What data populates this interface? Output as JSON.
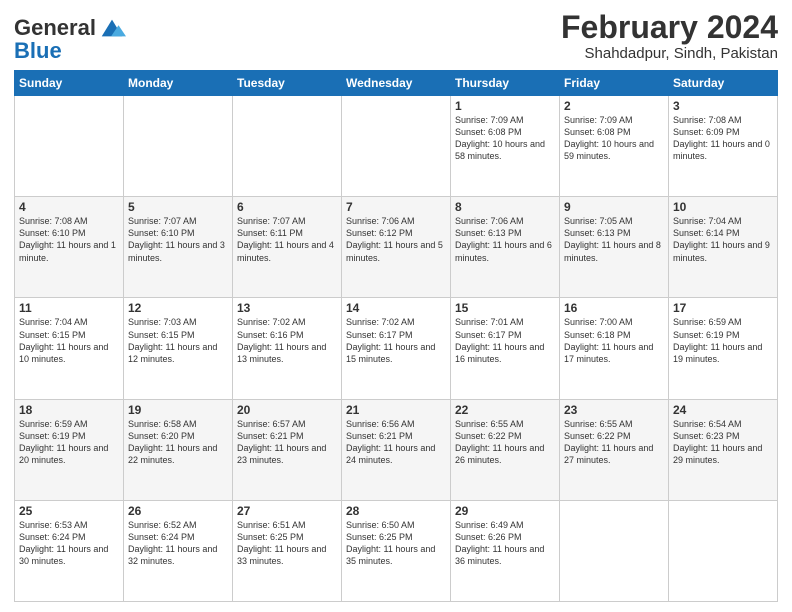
{
  "header": {
    "logo": {
      "text_general": "General",
      "text_blue": "Blue"
    },
    "title": "February 2024",
    "subtitle": "Shahdadpur, Sindh, Pakistan"
  },
  "weekdays": [
    "Sunday",
    "Monday",
    "Tuesday",
    "Wednesday",
    "Thursday",
    "Friday",
    "Saturday"
  ],
  "weeks": [
    [
      {
        "day": "",
        "info": ""
      },
      {
        "day": "",
        "info": ""
      },
      {
        "day": "",
        "info": ""
      },
      {
        "day": "",
        "info": ""
      },
      {
        "day": "1",
        "info": "Sunrise: 7:09 AM\nSunset: 6:08 PM\nDaylight: 10 hours and 58 minutes."
      },
      {
        "day": "2",
        "info": "Sunrise: 7:09 AM\nSunset: 6:08 PM\nDaylight: 10 hours and 59 minutes."
      },
      {
        "day": "3",
        "info": "Sunrise: 7:08 AM\nSunset: 6:09 PM\nDaylight: 11 hours and 0 minutes."
      }
    ],
    [
      {
        "day": "4",
        "info": "Sunrise: 7:08 AM\nSunset: 6:10 PM\nDaylight: 11 hours and 1 minute."
      },
      {
        "day": "5",
        "info": "Sunrise: 7:07 AM\nSunset: 6:10 PM\nDaylight: 11 hours and 3 minutes."
      },
      {
        "day": "6",
        "info": "Sunrise: 7:07 AM\nSunset: 6:11 PM\nDaylight: 11 hours and 4 minutes."
      },
      {
        "day": "7",
        "info": "Sunrise: 7:06 AM\nSunset: 6:12 PM\nDaylight: 11 hours and 5 minutes."
      },
      {
        "day": "8",
        "info": "Sunrise: 7:06 AM\nSunset: 6:13 PM\nDaylight: 11 hours and 6 minutes."
      },
      {
        "day": "9",
        "info": "Sunrise: 7:05 AM\nSunset: 6:13 PM\nDaylight: 11 hours and 8 minutes."
      },
      {
        "day": "10",
        "info": "Sunrise: 7:04 AM\nSunset: 6:14 PM\nDaylight: 11 hours and 9 minutes."
      }
    ],
    [
      {
        "day": "11",
        "info": "Sunrise: 7:04 AM\nSunset: 6:15 PM\nDaylight: 11 hours and 10 minutes."
      },
      {
        "day": "12",
        "info": "Sunrise: 7:03 AM\nSunset: 6:15 PM\nDaylight: 11 hours and 12 minutes."
      },
      {
        "day": "13",
        "info": "Sunrise: 7:02 AM\nSunset: 6:16 PM\nDaylight: 11 hours and 13 minutes."
      },
      {
        "day": "14",
        "info": "Sunrise: 7:02 AM\nSunset: 6:17 PM\nDaylight: 11 hours and 15 minutes."
      },
      {
        "day": "15",
        "info": "Sunrise: 7:01 AM\nSunset: 6:17 PM\nDaylight: 11 hours and 16 minutes."
      },
      {
        "day": "16",
        "info": "Sunrise: 7:00 AM\nSunset: 6:18 PM\nDaylight: 11 hours and 17 minutes."
      },
      {
        "day": "17",
        "info": "Sunrise: 6:59 AM\nSunset: 6:19 PM\nDaylight: 11 hours and 19 minutes."
      }
    ],
    [
      {
        "day": "18",
        "info": "Sunrise: 6:59 AM\nSunset: 6:19 PM\nDaylight: 11 hours and 20 minutes."
      },
      {
        "day": "19",
        "info": "Sunrise: 6:58 AM\nSunset: 6:20 PM\nDaylight: 11 hours and 22 minutes."
      },
      {
        "day": "20",
        "info": "Sunrise: 6:57 AM\nSunset: 6:21 PM\nDaylight: 11 hours and 23 minutes."
      },
      {
        "day": "21",
        "info": "Sunrise: 6:56 AM\nSunset: 6:21 PM\nDaylight: 11 hours and 24 minutes."
      },
      {
        "day": "22",
        "info": "Sunrise: 6:55 AM\nSunset: 6:22 PM\nDaylight: 11 hours and 26 minutes."
      },
      {
        "day": "23",
        "info": "Sunrise: 6:55 AM\nSunset: 6:22 PM\nDaylight: 11 hours and 27 minutes."
      },
      {
        "day": "24",
        "info": "Sunrise: 6:54 AM\nSunset: 6:23 PM\nDaylight: 11 hours and 29 minutes."
      }
    ],
    [
      {
        "day": "25",
        "info": "Sunrise: 6:53 AM\nSunset: 6:24 PM\nDaylight: 11 hours and 30 minutes."
      },
      {
        "day": "26",
        "info": "Sunrise: 6:52 AM\nSunset: 6:24 PM\nDaylight: 11 hours and 32 minutes."
      },
      {
        "day": "27",
        "info": "Sunrise: 6:51 AM\nSunset: 6:25 PM\nDaylight: 11 hours and 33 minutes."
      },
      {
        "day": "28",
        "info": "Sunrise: 6:50 AM\nSunset: 6:25 PM\nDaylight: 11 hours and 35 minutes."
      },
      {
        "day": "29",
        "info": "Sunrise: 6:49 AM\nSunset: 6:26 PM\nDaylight: 11 hours and 36 minutes."
      },
      {
        "day": "",
        "info": ""
      },
      {
        "day": "",
        "info": ""
      }
    ]
  ]
}
